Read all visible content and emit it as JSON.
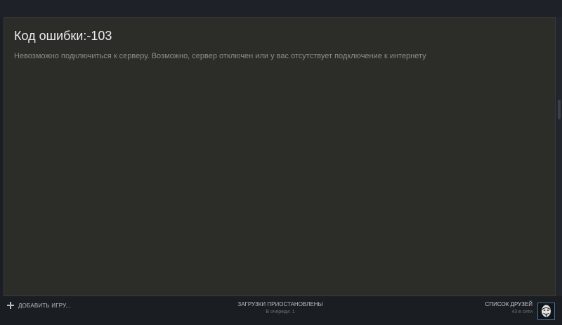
{
  "error": {
    "title": "Код ошибки:-103",
    "message": "Невозможно подключиться к серверу. Возможно, сервер отключен или у вас отсутствует подключение к интернету"
  },
  "footer": {
    "add_game_label": "ДОБАВИТЬ ИГРУ...",
    "add_game_icon": "plus-icon",
    "downloads_status": "ЗАГРУЗКИ ПРИОСТАНОВЛЕНЫ",
    "downloads_queue": "В очереди: 1",
    "friends_label": "СПИСОК ДРУЗЕЙ",
    "friends_online": "43 в сети"
  },
  "colors": {
    "background": "#1b1e24",
    "panel": "#2c2c29",
    "footer": "#1a1d22",
    "title_text": "#ececec",
    "message_text": "#8c8c89",
    "avatar_border": "#4b6e8c"
  }
}
